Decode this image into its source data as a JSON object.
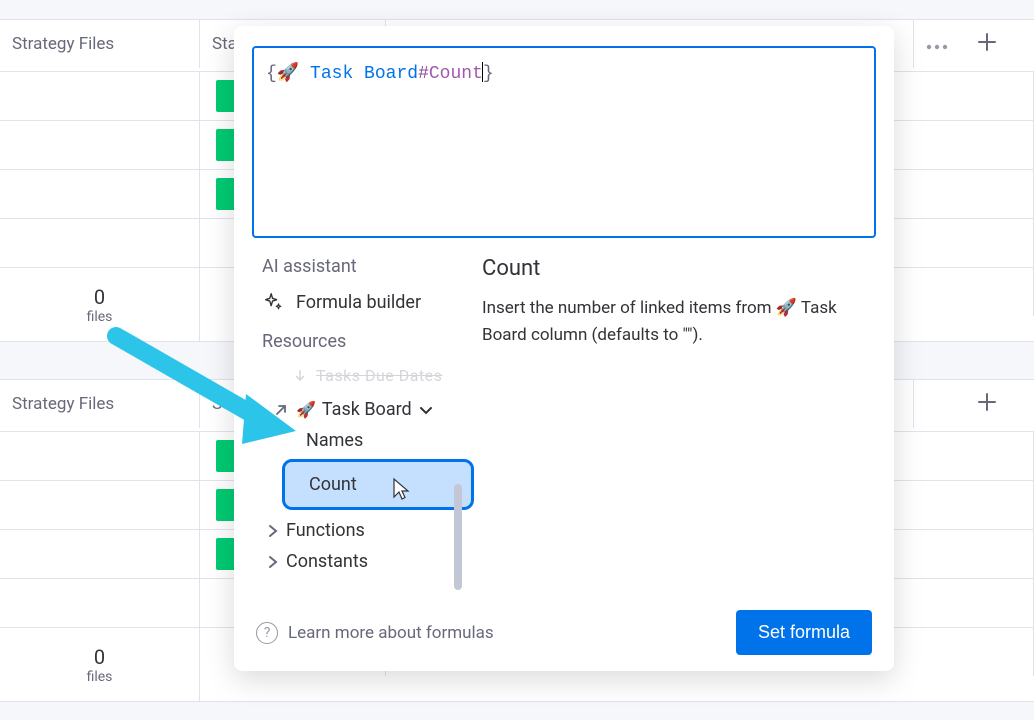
{
  "table": {
    "col1_header": "Strategy Files",
    "col2_partial": "Sta",
    "col2_header": "St",
    "files_count": "0",
    "files_label": "files"
  },
  "formula": {
    "brace_open": "{",
    "rocket": "🚀",
    "ref": " Task Board",
    "hash": "#",
    "field": "Count",
    "brace_close": "}"
  },
  "left": {
    "ai_heading": "AI assistant",
    "formula_builder": "Formula builder",
    "resources": "Resources",
    "truncated": "Tasks Due Dates",
    "task_board": "Task Board",
    "names": "Names",
    "count": "Count",
    "functions": "Functions",
    "constants": "Constants"
  },
  "right": {
    "title": "Count",
    "desc_prefix": "Insert the number of linked items from ",
    "desc_rocket": "🚀",
    "desc_suffix": " Task Board column (defaults to \"\")."
  },
  "footer": {
    "learn": "Learn more about formulas",
    "set_button": "Set formula"
  }
}
